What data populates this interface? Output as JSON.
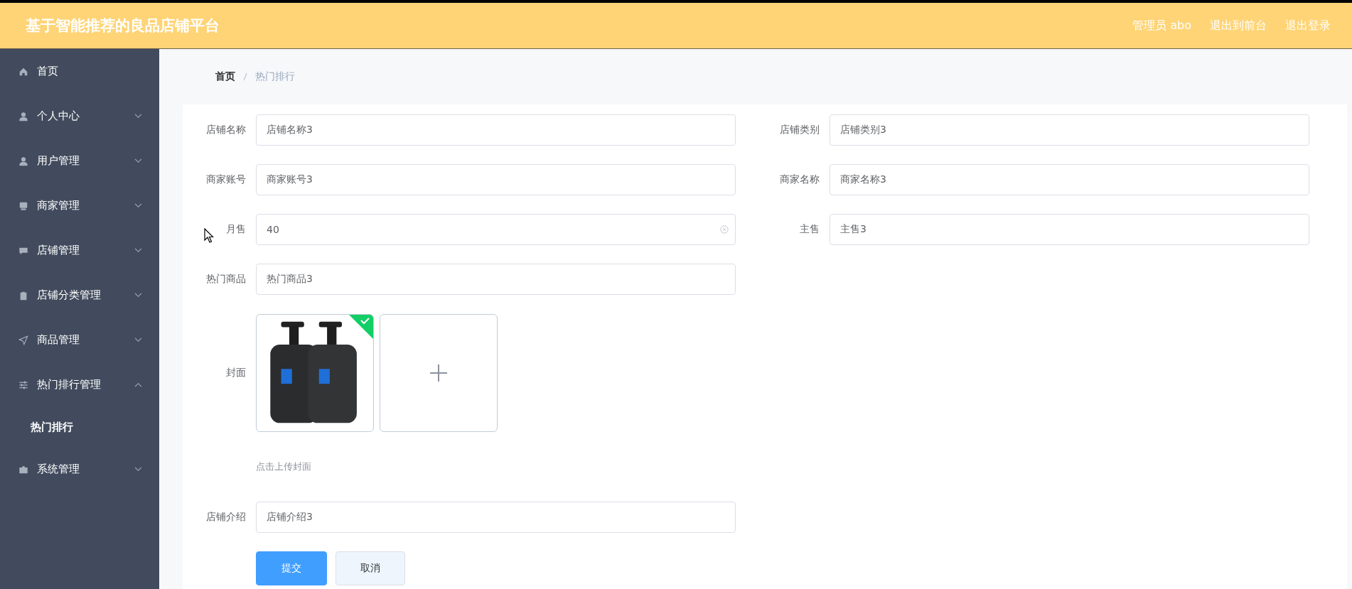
{
  "header": {
    "title": "基于智能推荐的良品店铺平台",
    "links": [
      {
        "text": "管理员 abo"
      },
      {
        "text": "退出到前台"
      },
      {
        "text": "退出登录"
      }
    ]
  },
  "sidebar": {
    "items": [
      {
        "label": "首页",
        "kind": "link"
      },
      {
        "label": "个人中心",
        "kind": "menu",
        "expanded": false
      },
      {
        "label": "用户管理",
        "kind": "menu",
        "expanded": false
      },
      {
        "label": "商家管理",
        "kind": "menu",
        "expanded": false
      },
      {
        "label": "店铺管理",
        "kind": "menu",
        "expanded": false
      },
      {
        "label": "店铺分类管理",
        "kind": "menu",
        "expanded": false
      },
      {
        "label": "商品管理",
        "kind": "menu",
        "expanded": false
      },
      {
        "label": "热门排行管理",
        "kind": "menu",
        "expanded": true,
        "children": [
          {
            "label": "热门排行",
            "selected": true
          }
        ]
      },
      {
        "label": "系统管理",
        "kind": "menu",
        "expanded": false
      }
    ]
  },
  "breadcrumb": [
    {
      "text": "首页",
      "current": false
    },
    {
      "text": "热门排行",
      "current": true
    }
  ],
  "form": {
    "fields": [
      {
        "label": "店铺名称",
        "value": "店铺名称3",
        "clearable": false
      },
      {
        "label": "店铺类别",
        "value": "店铺类别3",
        "clearable": false
      },
      {
        "label": "商家账号",
        "value": "商家账号3",
        "clearable": false
      },
      {
        "label": "商家名称",
        "value": "商家名称3",
        "clearable": false
      },
      {
        "label": "月售",
        "value": "40",
        "clearable": true
      },
      {
        "label": "主售",
        "value": "主售3",
        "clearable": false
      },
      {
        "label": "热门商品",
        "value": "热门商品3",
        "clearable": false
      }
    ],
    "upload": {
      "label": "封面",
      "uploaded": true,
      "hint": "点击上传封面"
    },
    "intro": {
      "label": "店铺介绍",
      "value": "店铺介绍3"
    },
    "buttons": [
      {
        "label": "提交",
        "kind": "primary"
      },
      {
        "label": "取消",
        "kind": "default"
      }
    ]
  }
}
